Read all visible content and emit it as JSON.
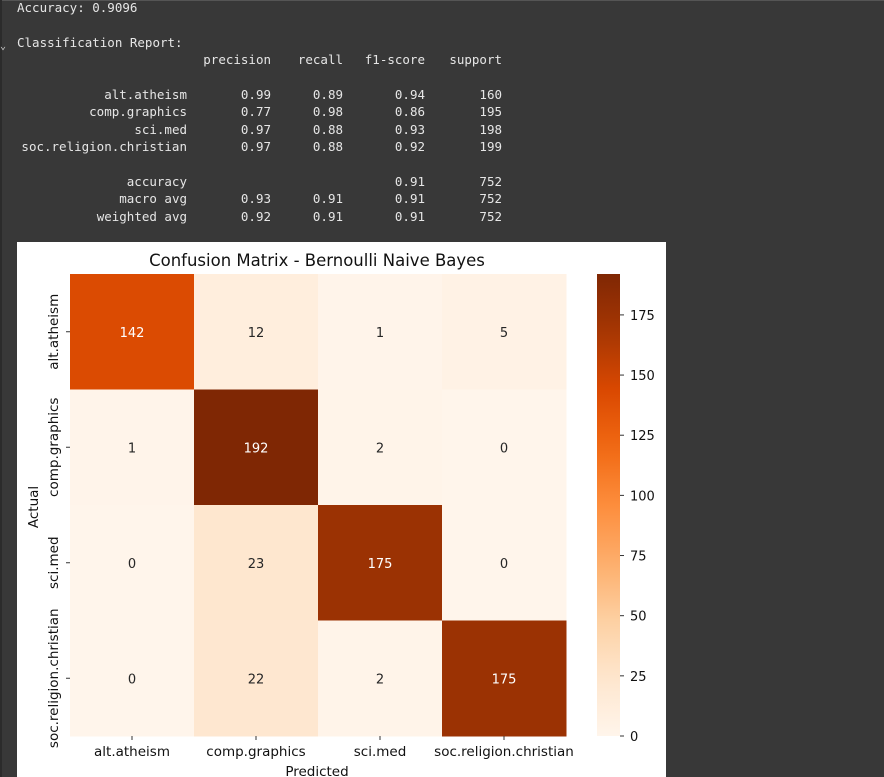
{
  "output": {
    "accuracy_line": "Accuracy: 0.9096",
    "report_title": "Classification Report:",
    "report_headers": [
      "precision",
      "recall",
      "f1-score",
      "support"
    ],
    "report_rows": [
      {
        "label": "alt.atheism",
        "precision": "0.99",
        "recall": "0.89",
        "f1": "0.94",
        "support": "160"
      },
      {
        "label": "comp.graphics",
        "precision": "0.77",
        "recall": "0.98",
        "f1": "0.86",
        "support": "195"
      },
      {
        "label": "sci.med",
        "precision": "0.97",
        "recall": "0.88",
        "f1": "0.93",
        "support": "198"
      },
      {
        "label": "soc.religion.christian",
        "precision": "0.97",
        "recall": "0.88",
        "f1": "0.92",
        "support": "199"
      }
    ],
    "summary_rows": [
      {
        "label": "accuracy",
        "precision": "",
        "recall": "",
        "f1": "0.91",
        "support": "752"
      },
      {
        "label": "macro avg",
        "precision": "0.93",
        "recall": "0.91",
        "f1": "0.91",
        "support": "752"
      },
      {
        "label": "weighted avg",
        "precision": "0.92",
        "recall": "0.91",
        "f1": "0.91",
        "support": "752"
      }
    ]
  },
  "chart_data": {
    "type": "heatmap",
    "title": "Confusion Matrix - Bernoulli Naive Bayes",
    "xlabel": "Predicted",
    "ylabel": "Actual",
    "x_categories": [
      "alt.atheism",
      "comp.graphics",
      "sci.med",
      "soc.religion.christian"
    ],
    "y_categories": [
      "alt.atheism",
      "comp.graphics",
      "sci.med",
      "soc.religion.christian"
    ],
    "values": [
      [
        142,
        12,
        1,
        5
      ],
      [
        1,
        192,
        2,
        0
      ],
      [
        0,
        23,
        175,
        0
      ],
      [
        0,
        22,
        2,
        175
      ]
    ],
    "colormap": "Oranges",
    "colorbar": {
      "min": 0,
      "max": 192,
      "ticks": [
        0,
        25,
        50,
        75,
        100,
        125,
        150,
        175
      ]
    },
    "colors": {
      "low": "#fff5eb",
      "high": "#7f2704",
      "annot_dark": "#262626",
      "annot_light": "#ffffff",
      "background": "#383838"
    }
  }
}
